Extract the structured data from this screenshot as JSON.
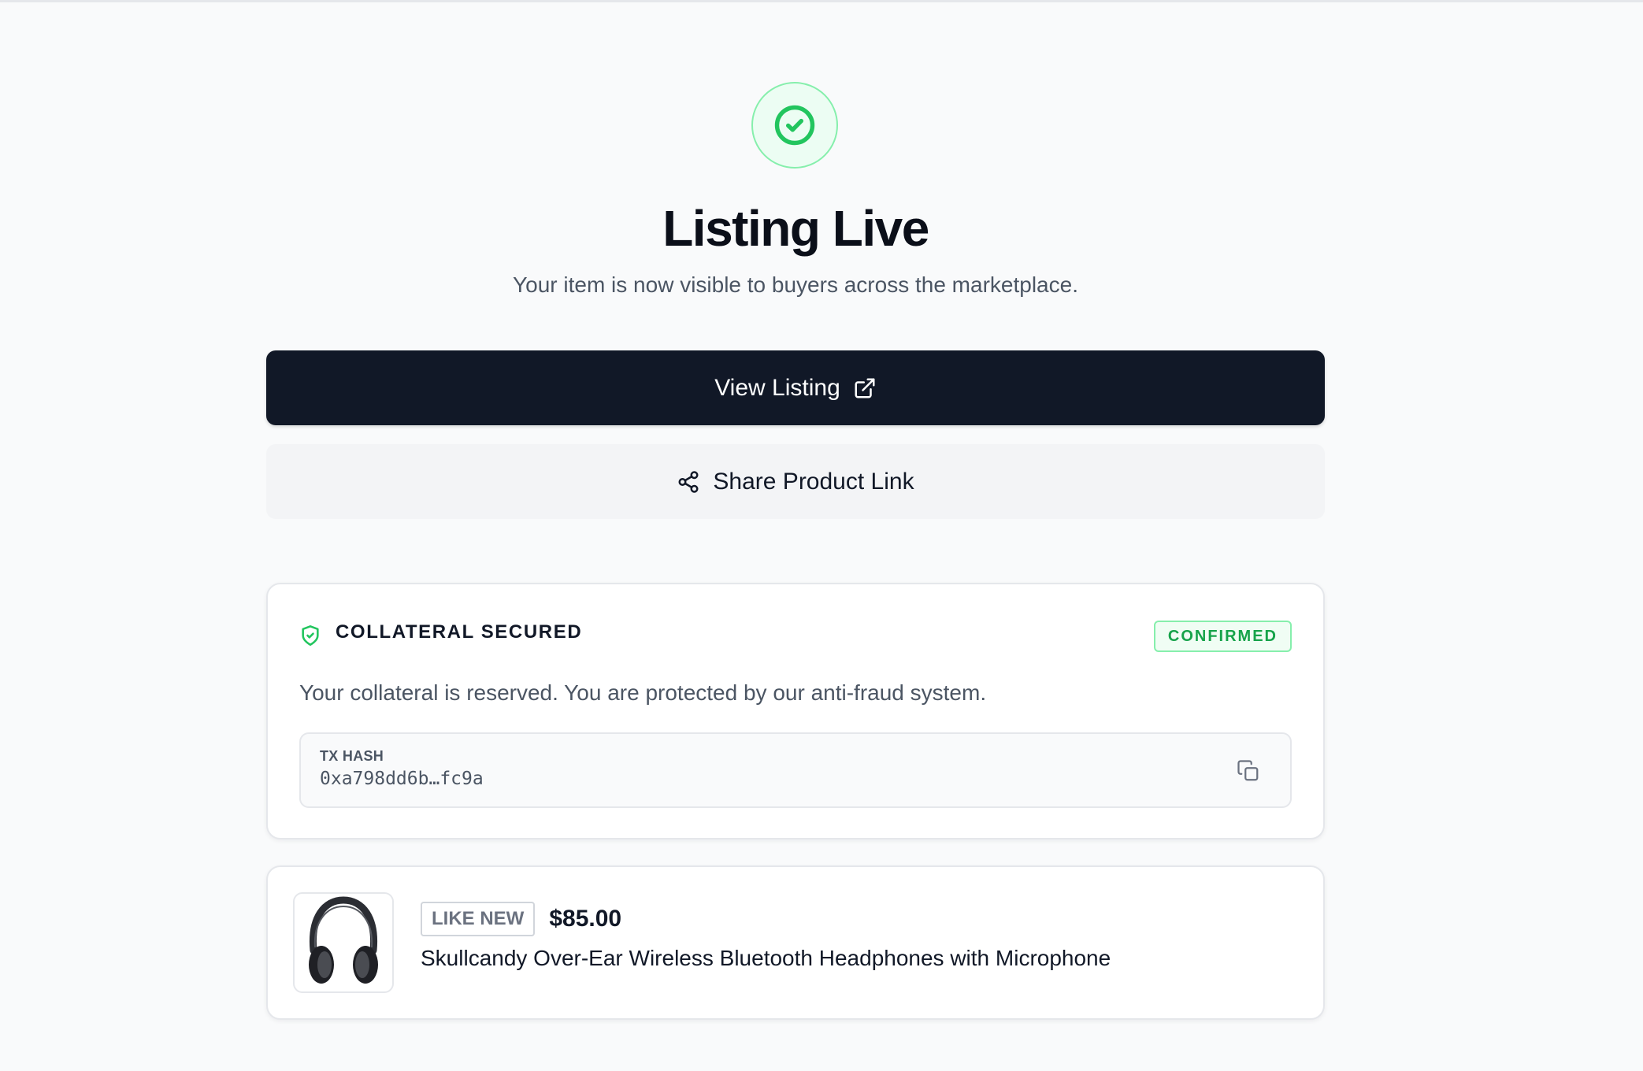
{
  "status": {
    "title": "Listing Live",
    "subtitle": "Your item is now visible to buyers across the marketplace.",
    "icon": "check-circle-icon",
    "accent_color": "#22c55e"
  },
  "actions": {
    "view_listing_label": "View Listing",
    "share_label": "Share Product Link"
  },
  "collateral": {
    "title": "COLLATERAL SECURED",
    "badge": "CONFIRMED",
    "description": "Your collateral is reserved. You are protected by our anti-fraud system.",
    "tx_label": "TX HASH",
    "tx_hash": "0xa798dd6b…fc9a"
  },
  "product": {
    "condition": "LIKE NEW",
    "price": "$85.00",
    "name": "Skullcandy Over-Ear Wireless Bluetooth Headphones with Microphone",
    "image_icon": "headphones-image"
  }
}
